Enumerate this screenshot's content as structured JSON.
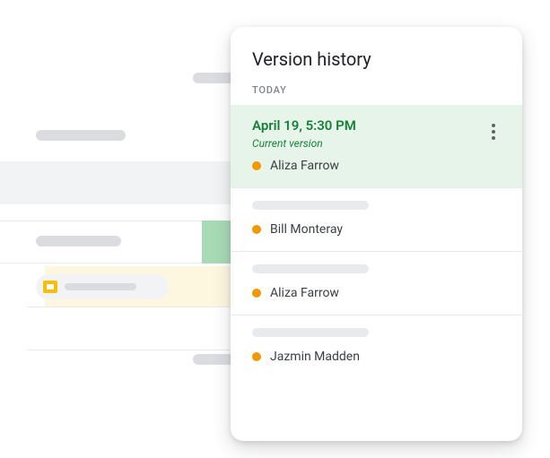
{
  "panel": {
    "title": "Version history",
    "section": "TODAY"
  },
  "versions": [
    {
      "timestamp": "April 19, 5:30 PM",
      "subtitle": "Current version",
      "editor": "Aliza Farrow",
      "current": true
    },
    {
      "editor": "Bill Monteray",
      "current": false
    },
    {
      "editor": "Aliza Farrow",
      "current": false
    },
    {
      "editor": "Jazmin Madden",
      "current": false
    }
  ],
  "colors": {
    "accent_green": "#188038",
    "highlight_green": "#e6f4ea",
    "editor_dot": "#f29900"
  }
}
